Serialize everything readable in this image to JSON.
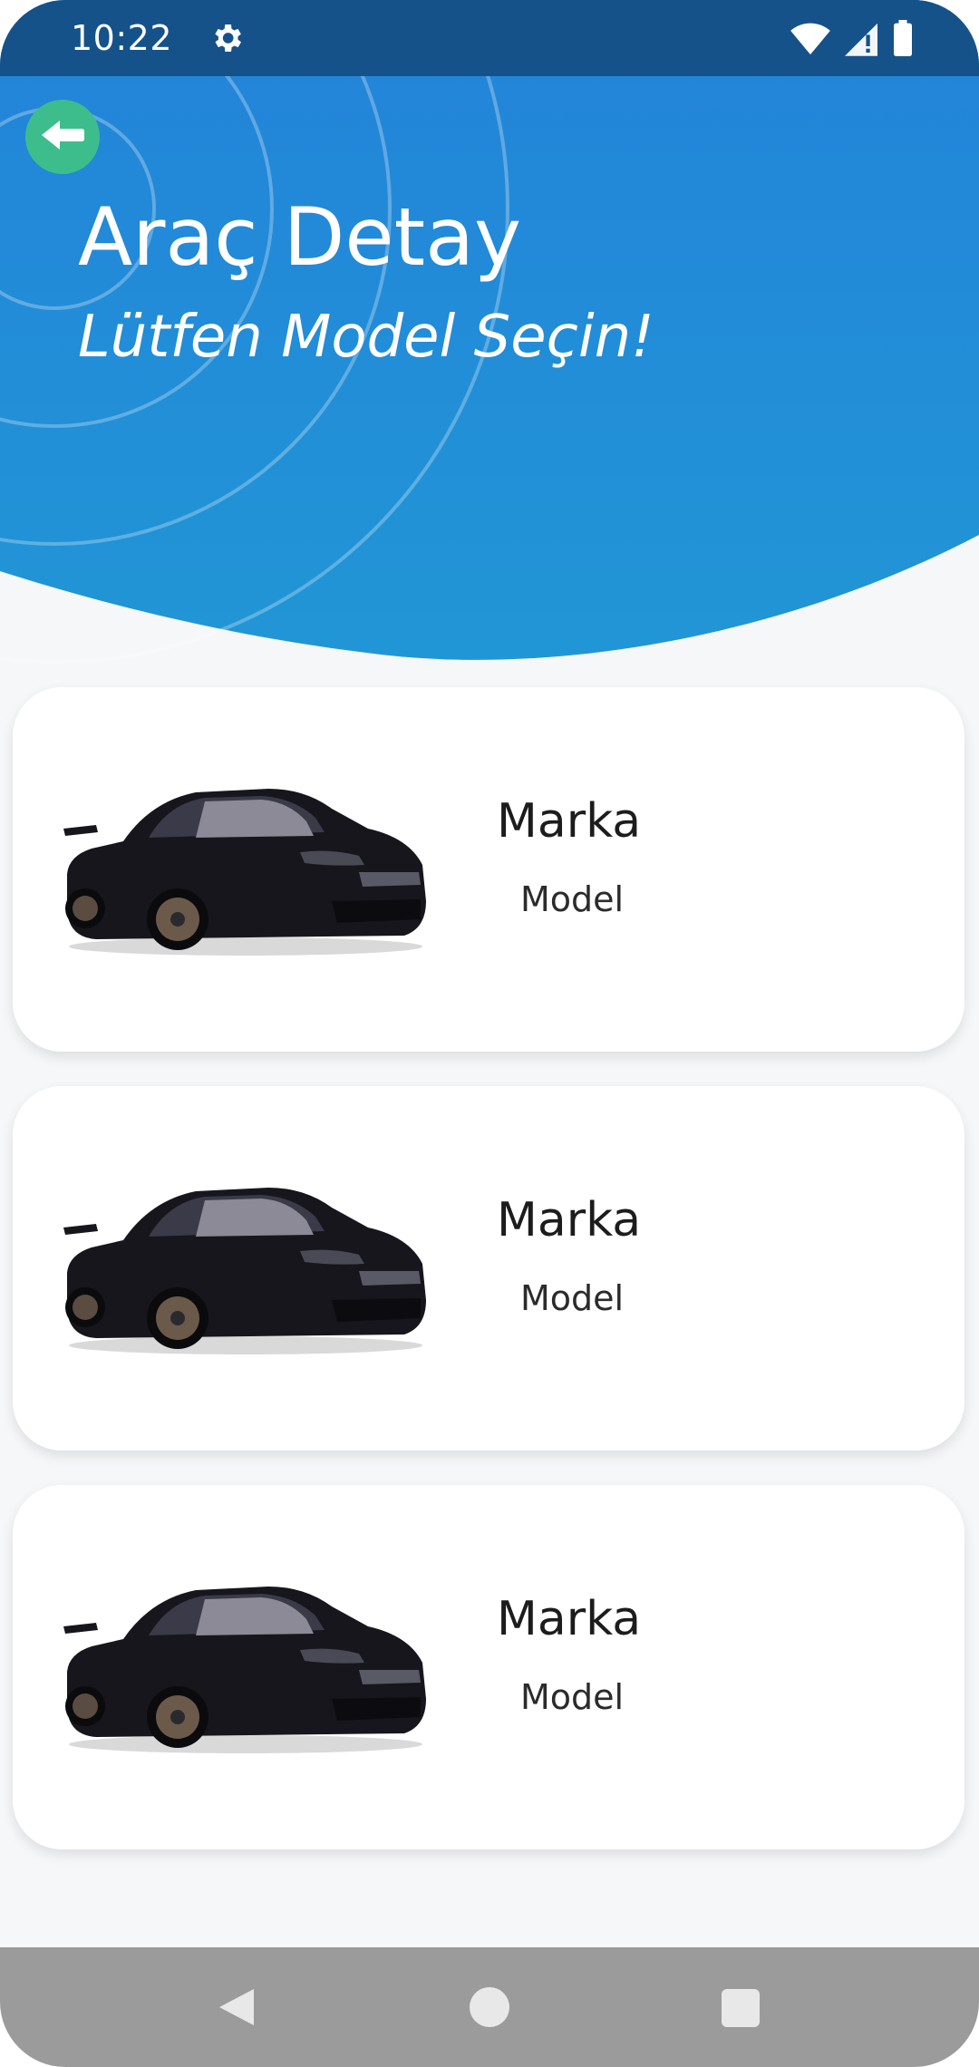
{
  "status_bar": {
    "time": "10:22",
    "icons": [
      "gear-icon",
      "wifi-icon",
      "signal-icon",
      "battery-icon"
    ]
  },
  "header": {
    "title": "Araç Detay",
    "subtitle": "Lütfen Model Seçin!",
    "back_icon": "arrow-left-icon",
    "colors": {
      "gradient_top": "#2383d9",
      "gradient_bottom": "#2196d6",
      "status_bar": "#155289",
      "back_button": "#3dbd8c"
    }
  },
  "cars": [
    {
      "brand": "Marka",
      "model": "Model"
    },
    {
      "brand": "Marka",
      "model": "Model"
    },
    {
      "brand": "Marka",
      "model": "Model"
    }
  ],
  "nav_bar": {
    "icons": [
      "nav-back-icon",
      "nav-home-icon",
      "nav-recents-icon"
    ]
  }
}
